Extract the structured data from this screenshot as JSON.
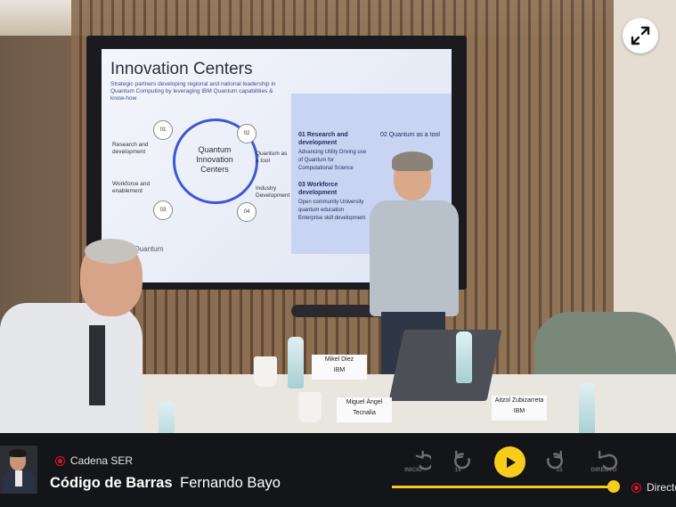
{
  "slide": {
    "title": "Innovation Centers",
    "subtitle": "Strategic partners developing regional and national leadership in Quantum Computing by leveraging IBM Quantum capabilities & know-how",
    "ring_label": "Quantum Innovation Centers",
    "nodes": [
      "01",
      "02",
      "03",
      "04"
    ],
    "left_labels": [
      "Research and development",
      "Workforce and enablement"
    ],
    "right_labels": [
      "Quantum as a tool",
      "Industry Development"
    ],
    "panel": {
      "item1_title": "01 Research and development",
      "item1_body": "Advancing Utility Driving use of Quantum for Computational Science",
      "item2_title": "02 Quantum as a tool",
      "item3_title": "03 Workforce development",
      "item3_body": "Open community University quantum education Enterprise skill development"
    },
    "logo": "IBM Quantum"
  },
  "name_cards": [
    "Mikel Diez\nIBM",
    "Miguel Ángel\nTecnalia",
    "Aitzol Zubizarreta\nIBM"
  ],
  "player": {
    "station": "Cadena SER",
    "show": "Código de Barras",
    "host": "Fernando Bayo",
    "controls": {
      "start_label": "INICIO",
      "back_label": "15",
      "forward_label": "15",
      "live_label": "DIRECTO"
    },
    "progress_fraction": 0.98,
    "direct_label": "Directo",
    "colors": {
      "accent": "#f7cc1a",
      "live_red": "#e2132b",
      "bar_bg": "#141518"
    }
  },
  "icons": {
    "fullscreen": "expand-arrows-icon",
    "start": "rewind-start-icon",
    "back": "rewind-15-icon",
    "play": "play-icon",
    "forward": "forward-15-icon",
    "live": "jump-live-icon"
  }
}
